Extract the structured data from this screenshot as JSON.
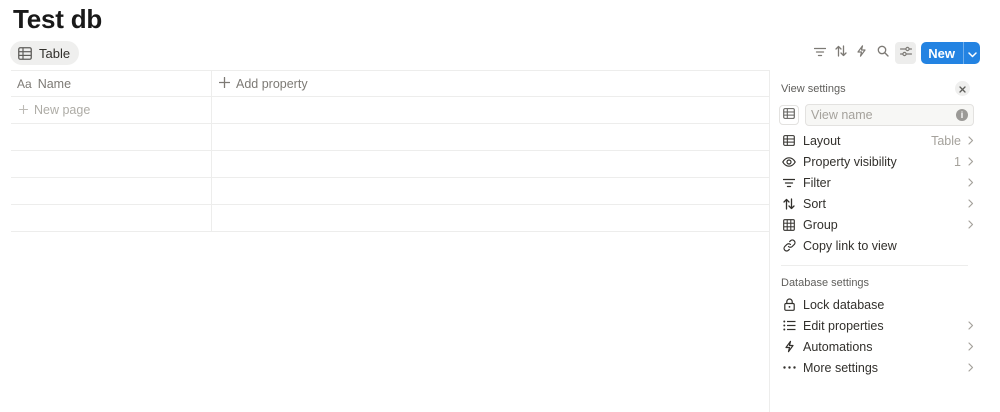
{
  "page": {
    "title": "Test db"
  },
  "view_tab": {
    "label": "Table",
    "icon": "table-icon"
  },
  "toolbar": {
    "icons": [
      "filter-icon",
      "sort-icon",
      "lightning-icon",
      "search-icon",
      "settings-sliders-icon"
    ],
    "new_label": "New",
    "accent": "#2383e2"
  },
  "table": {
    "columns": [
      {
        "label": "Name",
        "icon": "text-property-icon",
        "icon_text": "Aa"
      },
      {
        "label": "Add property",
        "icon": "plus-icon"
      }
    ],
    "new_page_label": "New page"
  },
  "panel": {
    "title": "View settings",
    "view_name_placeholder": "View name",
    "view_items": [
      {
        "label": "Layout",
        "value": "Table",
        "icon": "table-icon"
      },
      {
        "label": "Property visibility",
        "value": "1",
        "icon": "eye-icon"
      },
      {
        "label": "Filter",
        "value": "",
        "icon": "filter-icon"
      },
      {
        "label": "Sort",
        "value": "",
        "icon": "sort-icon"
      },
      {
        "label": "Group",
        "value": "",
        "icon": "group-icon"
      },
      {
        "label": "Copy link to view",
        "value": "",
        "icon": "link-icon"
      }
    ],
    "database_title": "Database settings",
    "db_items": [
      {
        "label": "Lock database",
        "icon": "lock-icon"
      },
      {
        "label": "Edit properties",
        "icon": "list-icon"
      },
      {
        "label": "Automations",
        "icon": "lightning-icon"
      },
      {
        "label": "More settings",
        "icon": "more-icon"
      }
    ]
  }
}
